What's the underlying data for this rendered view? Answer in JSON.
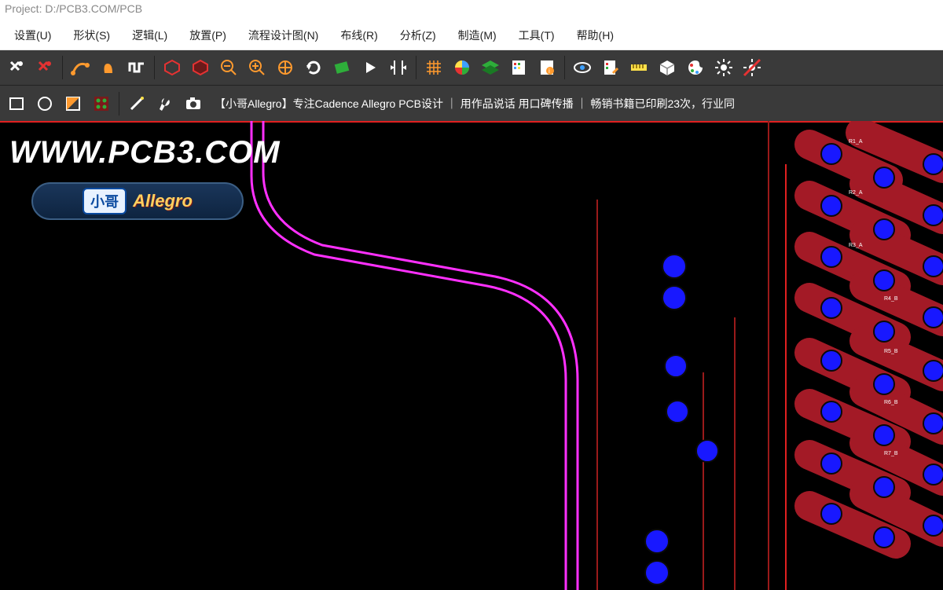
{
  "title": "Project: D:/PCB3.COM/PCB",
  "menu": [
    {
      "label": "设置(U)"
    },
    {
      "label": "形状(S)"
    },
    {
      "label": "逻辑(L)"
    },
    {
      "label": "放置(P)"
    },
    {
      "label": "流程设计图(N)"
    },
    {
      "label": "布线(R)"
    },
    {
      "label": "分析(Z)"
    },
    {
      "label": "制造(M)"
    },
    {
      "label": "工具(T)"
    },
    {
      "label": "帮助(H)"
    }
  ],
  "promo_text": "【小哥Allegro】专注Cadence Allegro PCB设计  ｜ 用作品说话 用口碑传播  ｜ 畅销书籍已印刷23次，行业同",
  "watermark": "WWW.PCB3.COM",
  "logo": {
    "cn": "小哥",
    "en": "Allegro"
  },
  "icons_row1": [
    "pin-white",
    "pin-red",
    "route-orange",
    "hand-orange",
    "square-wave",
    "hex-red",
    "hex-red-fill",
    "zoom-out",
    "zoom-in",
    "zoom-target",
    "refresh",
    "chip-green",
    "play",
    "align",
    "grid",
    "color-wheel",
    "layers-green",
    "sheet-grid",
    "sheet-info",
    "eye",
    "sheet-edit",
    "ruler",
    "cube",
    "palette",
    "sun",
    "sun-strike"
  ],
  "icons_row2": [
    "rect-outline",
    "circle-outline",
    "split-diag",
    "dots-green",
    "wand",
    "wrench",
    "camera"
  ],
  "colors": {
    "toolbar_bg": "#3a3a3a",
    "icon_orange": "#ff9a2e",
    "icon_red": "#e53232",
    "icon_green": "#2eae3a",
    "icon_white": "#ffffff",
    "icon_yellow": "#ffe14a",
    "icon_blue": "#3ca0ff",
    "trace_magenta": "#ff30ff",
    "trace_red": "#a31a26",
    "pad_blue": "#1818ff"
  }
}
